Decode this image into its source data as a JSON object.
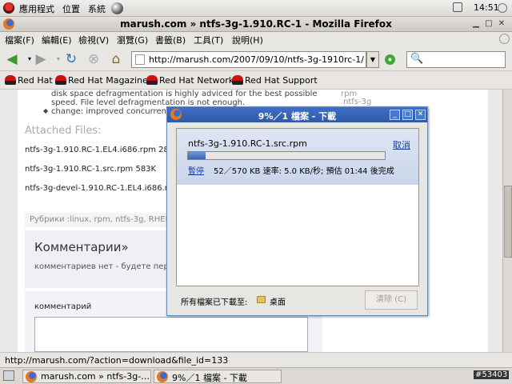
{
  "gnome_panel": {
    "menus": [
      "應用程式",
      "位置",
      "系統"
    ],
    "clock": "14:51"
  },
  "window": {
    "title": "marush.com » ntfs-3g-1.910.RC-1 - Mozilla Firefox"
  },
  "menubar": [
    "檔案(F)",
    "編輯(E)",
    "檢視(V)",
    "瀏覽(G)",
    "書籤(B)",
    "工具(T)",
    "說明(H)"
  ],
  "navigation": {
    "url": "http://marush.com/2007/09/10/ntfs-3g-1910rc-1/",
    "search_placeholder": ""
  },
  "bookmarks": [
    "Red Hat",
    "Red Hat Magazine",
    "Red Hat Network",
    "Red Hat Support"
  ],
  "page": {
    "lines": [
      "disk space defragmentation is highly adviced for the best possible",
      "speed. File level defragmentation is not enough.",
      "change: improved concurrent"
    ],
    "attached_heading": "Attached  Files:",
    "files": [
      "ntfs-3g-1.910.RC-1.EL4.i686.rpm 281",
      "ntfs-3g-1.910.RC-1.src.rpm 583K",
      "ntfs-3g-devel-1.910.RC-1.EL4.i686.rp"
    ],
    "rubrics": "Рубрики :linux, rpm, ntfs-3g, RHEL4",
    "comments_heading": "Комментарии»",
    "comments_note": "комментариев нет - будете перв",
    "comment_label": "комментарий",
    "sidebar_tags": [
      "rpm",
      "ntfs-3g"
    ]
  },
  "download_dialog": {
    "title": "9%／1 檔案 - 下載",
    "filename": "ntfs-3g-1.910.RC-1.src.rpm",
    "cancel_label": "取消",
    "pause_label": "暫停",
    "status": "52／570 KB 速率: 5.0 KB/秒; 預估 01:44 後完成",
    "progress": 0.09,
    "save_to_label": "所有檔案已下載至:",
    "folder": "桌面",
    "clear_label": "清除 (C)"
  },
  "status_bar": {
    "text": "http://marush.com/?action=download&file_id=133"
  },
  "taskbar": {
    "tasks": [
      "marush.com » ntfs-3g-…",
      "9%／1 檔案 - 下載"
    ],
    "badge": "#53403"
  },
  "colors": {
    "title_blue": "#2f5aa6",
    "progress_blue": "#3c67b5",
    "link_blue": "#1a3ea8"
  }
}
